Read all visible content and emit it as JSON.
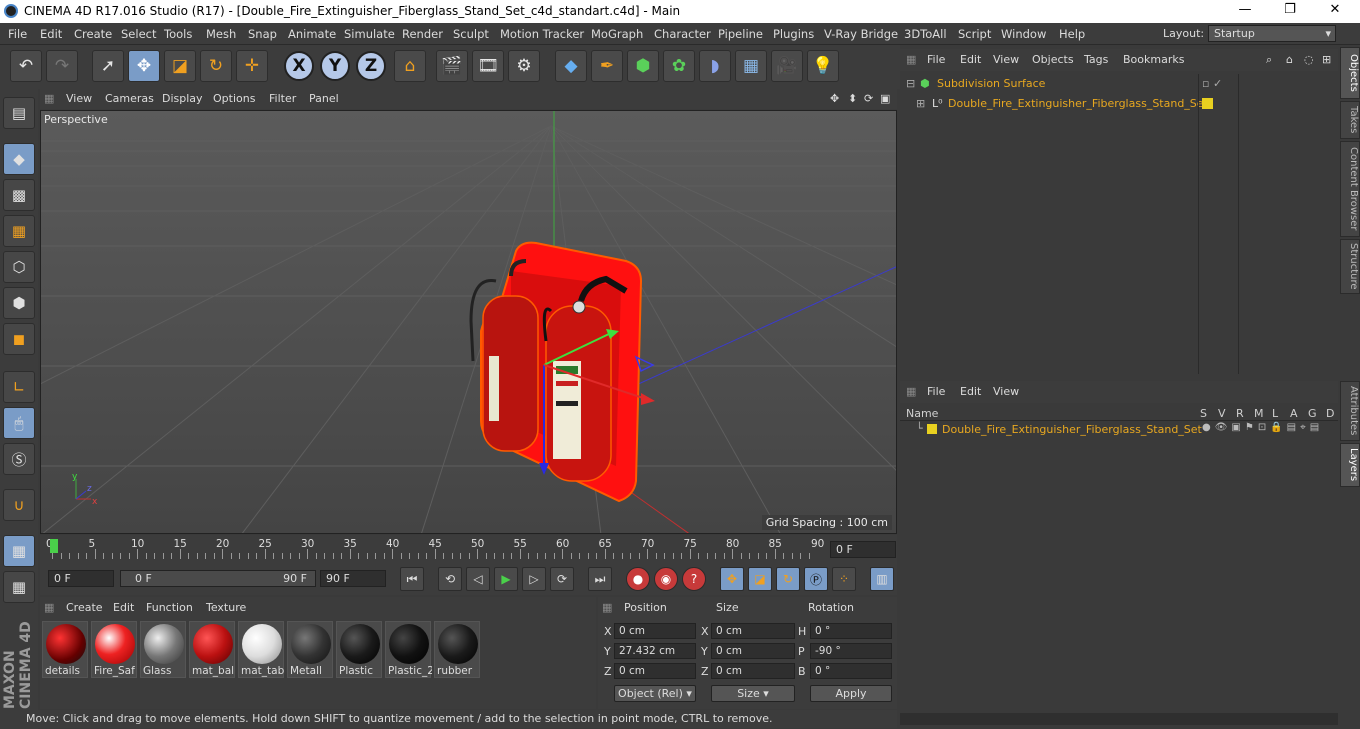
{
  "window": {
    "title": "CINEMA 4D R17.016 Studio (R17) - [Double_Fire_Extinguisher_Fiberglass_Stand_Set_c4d_standart.c4d] - Main"
  },
  "menubar": {
    "items": [
      "File",
      "Edit",
      "Create",
      "Select",
      "Tools",
      "Mesh",
      "Snap",
      "Animate",
      "Simulate",
      "Render",
      "Sculpt",
      "Motion Tracker",
      "MoGraph",
      "Character",
      "Pipeline",
      "Plugins",
      "V-Ray Bridge",
      "3DToAll",
      "Script",
      "Window",
      "Help"
    ],
    "layout_label": "Layout:",
    "layout_value": "Startup"
  },
  "toolbar": {
    "icons": [
      "undo-icon",
      "redo-icon",
      "select-icon",
      "move-icon",
      "scale-icon",
      "rotate-icon",
      "move-snap-icon",
      "x-axis",
      "y-axis",
      "z-axis",
      "world-coord-icon",
      "render-view-icon",
      "render-picture-viewer-icon",
      "render-settings-icon",
      "cube-icon",
      "pen-icon",
      "subdivision-icon",
      "array-icon",
      "deformer-icon",
      "floor-icon",
      "camera-icon",
      "light-icon"
    ],
    "x": "X",
    "y": "Y",
    "z": "Z"
  },
  "viewport_menu": {
    "items": [
      "View",
      "Cameras",
      "Display",
      "Options",
      "Filter",
      "Panel"
    ]
  },
  "viewport": {
    "camera": "Perspective",
    "grid_spacing": "Grid Spacing : 100 cm"
  },
  "timeline": {
    "ticks": [
      "0",
      "5",
      "10",
      "15",
      "20",
      "25",
      "30",
      "35",
      "40",
      "45",
      "50",
      "55",
      "60",
      "65",
      "70",
      "75",
      "80",
      "85",
      "90"
    ],
    "current_frame": "0 F"
  },
  "transport": {
    "start": "0 F",
    "range_start": "0 F",
    "range_end": "90 F",
    "end": "90 F"
  },
  "materials": {
    "menu": [
      "Create",
      "Edit",
      "Function",
      "Texture"
    ],
    "items": [
      "details",
      "Fire_Saf",
      "Glass",
      "mat_bal",
      "mat_tab",
      "Metall",
      "Plastic",
      "Plastic_2",
      "rubber"
    ]
  },
  "attributes": {
    "headers": [
      "Position",
      "Size",
      "Rotation"
    ],
    "pos": {
      "x": "0 cm",
      "y": "27.432 cm",
      "z": "0 cm"
    },
    "size": {
      "x": "0 cm",
      "y": "0 cm",
      "z": "0 cm"
    },
    "rot": {
      "h": "0 °",
      "p": "-90 °",
      "b": "0 °"
    },
    "labels": {
      "x": "X",
      "y": "Y",
      "z": "Z",
      "h": "H",
      "p": "P",
      "b": "B"
    },
    "mode": "Object (Rel)",
    "size_mode": "Size",
    "apply": "Apply"
  },
  "objects": {
    "menu": [
      "File",
      "Edit",
      "View",
      "Objects",
      "Tags",
      "Bookmarks"
    ],
    "rows": [
      "Subdivision Surface",
      "Double_Fire_Extinguisher_Fiberglass_Stand_Set"
    ]
  },
  "layers": {
    "menu": [
      "File",
      "Edit",
      "View"
    ],
    "name_col": "Name",
    "cols": [
      "S",
      "V",
      "R",
      "M",
      "L",
      "A",
      "G",
      "D"
    ],
    "row": "Double_Fire_Extinguisher_Fiberglass_Stand_Set"
  },
  "side_tabs": [
    "Objects",
    "Takes",
    "Content Browser",
    "Structure",
    "Attributes",
    "Layers"
  ],
  "status": "Move: Click and drag to move elements. Hold down SHIFT to quantize movement / add to the selection in point mode, CTRL to remove.",
  "brand": "MAXON CINEMA 4D",
  "colors": {
    "accent": "#7a9cc7",
    "object_name": "#e8a820",
    "extinguisher": "#e0151a",
    "stand": "#f01d1d"
  }
}
